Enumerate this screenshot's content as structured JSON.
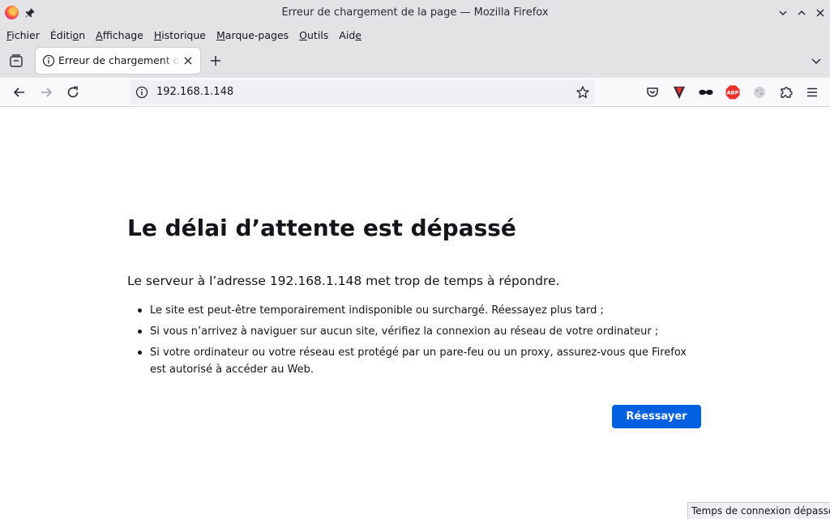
{
  "window": {
    "title": "Erreur de chargement de la page — Mozilla Firefox"
  },
  "menubar": {
    "items": [
      {
        "before": "",
        "mnemonic": "F",
        "after": "ichier"
      },
      {
        "before": "Éditi",
        "mnemonic": "o",
        "after": "n"
      },
      {
        "before": "",
        "mnemonic": "A",
        "after": "ffichage"
      },
      {
        "before": "",
        "mnemonic": "H",
        "after": "istorique"
      },
      {
        "before": "",
        "mnemonic": "M",
        "after": "arque-pages"
      },
      {
        "before": "",
        "mnemonic": "O",
        "after": "utils"
      },
      {
        "before": "Aid",
        "mnemonic": "e",
        "after": ""
      }
    ]
  },
  "tabs": [
    {
      "title": "Erreur de chargement de la page",
      "active": true
    }
  ],
  "navbar": {
    "url": "192.168.1.148",
    "extensions": [
      "pocket-icon",
      "vivaldi-v-icon",
      "incognito-glasses-icon",
      "adblock-plus-icon",
      "cookie-icon",
      "extensions-puzzle-icon",
      "hamburger-menu-icon"
    ]
  },
  "error_page": {
    "title": "Le délai d’attente est dépassé",
    "description": "Le serveur à l’adresse 192.168.1.148 met trop de temps à répondre.",
    "suggestions": [
      "Le site est peut-être temporairement indisponible ou surchargé. Réessayez plus tard ;",
      "Si vous n’arrivez à naviguer sur aucun site, vérifiez la connexion au réseau de votre ordinateur ;",
      "Si votre ordinateur ou votre réseau est protégé par un pare-feu ou un proxy, assurez-vous que Firefox est autorisé à accéder au Web."
    ],
    "retry_label": "Réessayer"
  },
  "status": {
    "text": "Temps de connexion dépassé"
  },
  "colors": {
    "accent": "#0061e0",
    "chrome": "#e3e3e5",
    "toolbar": "#f9f9fb",
    "abp_red": "#e8302f"
  }
}
